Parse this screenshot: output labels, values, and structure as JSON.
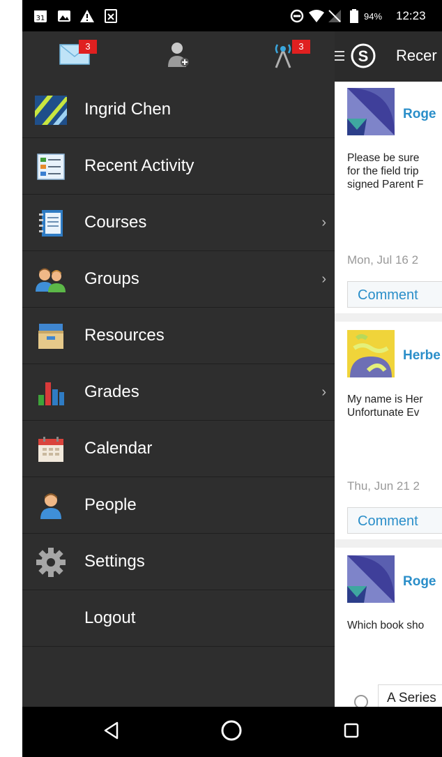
{
  "status_bar": {
    "battery_percent": "94%",
    "time": "12:23",
    "calendar_day": "31"
  },
  "drawer": {
    "top_icons": [
      {
        "name": "messages",
        "badge": "3"
      },
      {
        "name": "requests",
        "badge": ""
      },
      {
        "name": "notifications",
        "badge": "3"
      }
    ],
    "items": [
      {
        "label": "Ingrid Chen",
        "icon": "profile-avatar-icon",
        "chevron": false
      },
      {
        "label": "Recent Activity",
        "icon": "activity-list-icon",
        "chevron": false
      },
      {
        "label": "Courses",
        "icon": "notebook-icon",
        "chevron": true
      },
      {
        "label": "Groups",
        "icon": "group-people-icon",
        "chevron": true
      },
      {
        "label": "Resources",
        "icon": "file-box-icon",
        "chevron": false
      },
      {
        "label": "Grades",
        "icon": "bar-chart-icon",
        "chevron": true
      },
      {
        "label": "Calendar",
        "icon": "calendar-icon",
        "chevron": false
      },
      {
        "label": "People",
        "icon": "person-icon",
        "chevron": false
      },
      {
        "label": "Settings",
        "icon": "gear-icon",
        "chevron": false
      },
      {
        "label": "Logout",
        "icon": "",
        "chevron": false
      }
    ]
  },
  "main": {
    "app_title": "Recer",
    "posts": [
      {
        "author": "Roge",
        "lines": [
          "Please be sure",
          "for the field trip",
          "signed Parent F"
        ],
        "date": "Mon, Jul 16 2",
        "comment_label": "Comment"
      },
      {
        "author": "Herbe",
        "lines": [
          "My name is Her",
          "Unfortunate Ev"
        ],
        "date": "Thu, Jun 21 2",
        "comment_label": "Comment"
      },
      {
        "author": "Roge",
        "lines": [
          "Which book sho"
        ],
        "poll_option": "A Series"
      }
    ]
  },
  "colors": {
    "drawer_bg": "#2e2e2e",
    "accent_blue": "#2a8ec9",
    "badge_red": "#e02020"
  }
}
